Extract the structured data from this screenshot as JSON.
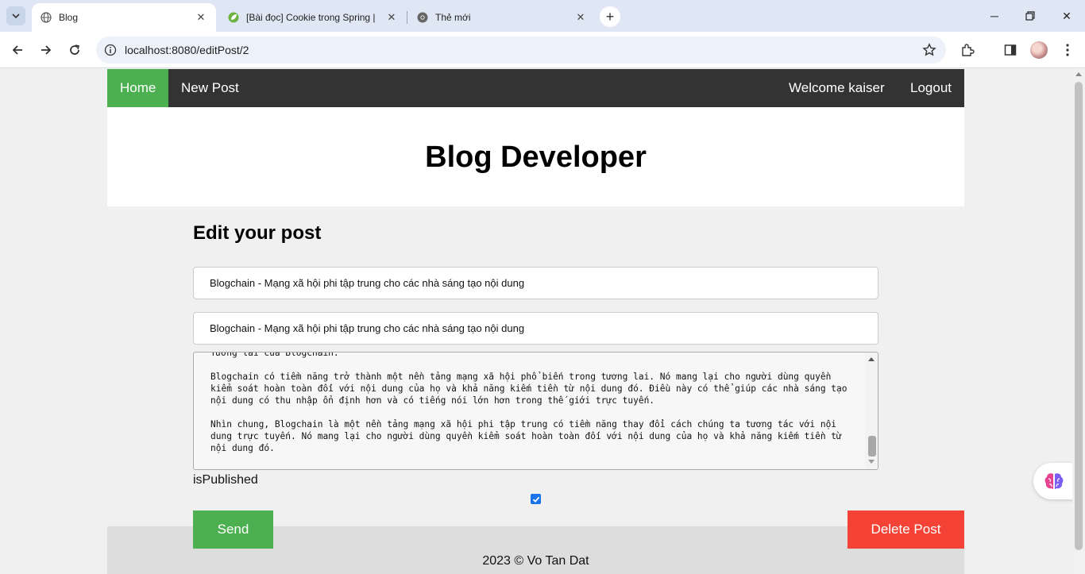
{
  "browser": {
    "tabs": [
      {
        "title": "Blog",
        "favicon": "globe-icon",
        "active": true
      },
      {
        "title": "[Bài đọc] Cookie trong Spring |",
        "favicon": "spring-leaf-icon",
        "active": false
      },
      {
        "title": "Thẻ mới",
        "favicon": "chrome-icon",
        "active": false
      }
    ],
    "url": "localhost:8080/editPost/2"
  },
  "navbar": {
    "home": "Home",
    "new_post": "New Post",
    "welcome": "Welcome kaiser",
    "logout": "Logout"
  },
  "header": {
    "title": "Blog Developer"
  },
  "form": {
    "heading": "Edit your post",
    "title_value": "Blogchain - Mạng xã hội phi tập trung cho các nhà sáng tạo nội dung",
    "description_value": "Blogchain - Mạng xã hội phi tập trung cho các nhà sáng tạo nội dung",
    "content_value": "Tương lai của Blogchain:\n\nBlogchain có tiềm năng trở thành một nền tảng mạng xã hội phổ biến trong tương lai. Nó mang lại cho người dùng quyền kiểm soát hoàn toàn đối với nội dung của họ và khả năng kiếm tiền từ nội dung đó. Điều này có thể giúp các nhà sáng tạo nội dung có thu nhập ổn định hơn và có tiếng nói lớn hơn trong thế giới trực tuyến.\n\nNhìn chung, Blogchain là một nền tảng mạng xã hội phi tập trung có tiềm năng thay đổi cách chúng ta tương tác với nội dung trực tuyến. Nó mang lại cho người dùng quyền kiểm soát hoàn toàn đối với nội dung của họ và khả năng kiếm tiền từ nội dung đó.",
    "published_label": "isPublished",
    "published_checked": true,
    "send_label": "Send",
    "delete_label": "Delete Post"
  },
  "footer": {
    "text": "2023 © Vo Tan Dat"
  },
  "colors": {
    "nav_bg": "#333333",
    "home_active": "#4caf50",
    "send": "#4caf50",
    "delete": "#f44336",
    "footer_bg": "#dddddd"
  }
}
